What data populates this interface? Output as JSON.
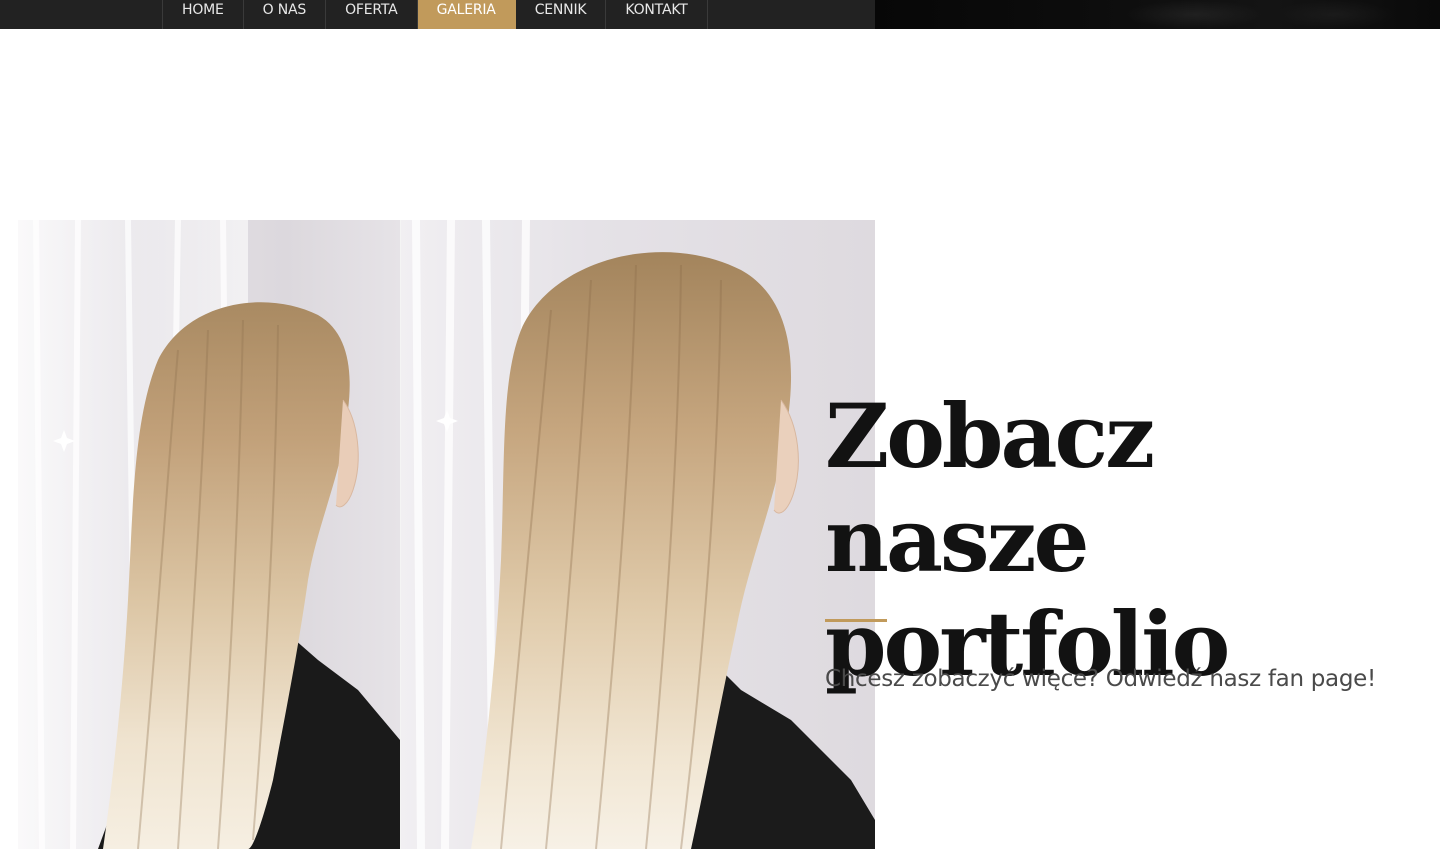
{
  "nav": {
    "items": [
      {
        "label": "HOME"
      },
      {
        "label": "O NAS"
      },
      {
        "label": "OFERTA"
      },
      {
        "label": "GALERIA",
        "active": true
      },
      {
        "label": "CENNIK"
      },
      {
        "label": "KONTAKT"
      }
    ]
  },
  "hero": {
    "title_line1": "Zobacz nasze",
    "title_line2": "portfolio",
    "subtitle": "Chcesz zobaczyć więce? Odwiedź nasz fan page!"
  },
  "colors": {
    "accent": "#c19a5b",
    "topbar": "#222222",
    "heading": "#121212",
    "body_text": "#4a4a4a"
  }
}
